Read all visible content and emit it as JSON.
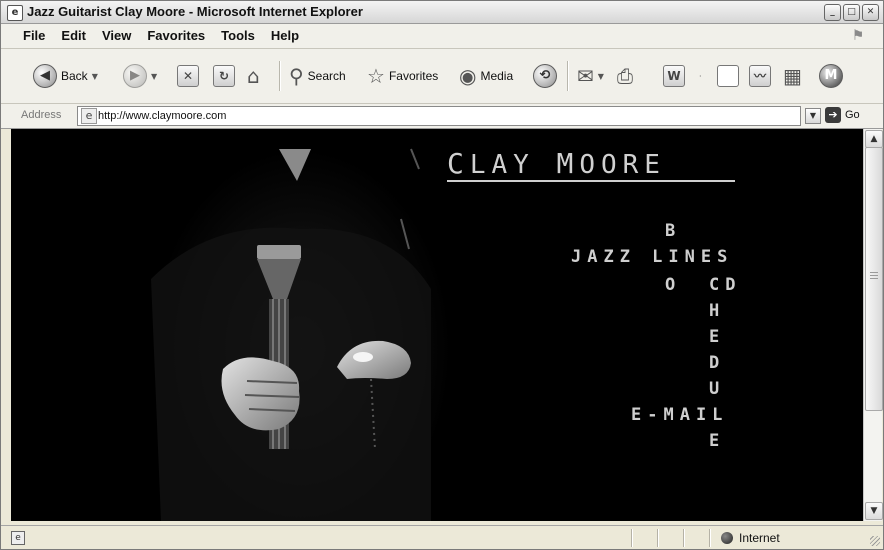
{
  "window": {
    "title": "Jazz Guitarist Clay Moore - Microsoft Internet Explorer",
    "app_icon": "ie-page-icon",
    "buttons": {
      "minimize": "minimize-icon",
      "maximize": "maximize-icon",
      "close": "close-icon"
    }
  },
  "menu": {
    "items": [
      "File",
      "Edit",
      "View",
      "Favorites",
      "Tools",
      "Help"
    ],
    "logo": "windows-flag-icon"
  },
  "toolbar": {
    "back_label": "Back",
    "search_label": "Search",
    "favorites_label": "Favorites",
    "media_label": "Media",
    "icons": [
      "back-icon",
      "forward-icon",
      "stop-icon",
      "refresh-icon",
      "home-icon",
      "search-icon",
      "favorites-icon",
      "media-icon",
      "history-icon",
      "mail-icon",
      "print-icon",
      "edit-icon",
      "discuss-icon",
      "messenger-icon",
      "research-icon",
      "msn-icon"
    ]
  },
  "address": {
    "label": "Address",
    "url": "http://www.claymoore.com",
    "go_label": "Go"
  },
  "site": {
    "title_first_initial": "C",
    "title_first_rest": "LAY",
    "title_last_initial": "M",
    "title_last_rest": "OORE",
    "nav": {
      "bio_b": "B",
      "jazz_lines": "JAZZ LINES",
      "bio_o": "O",
      "cd": "CD",
      "schedule_h": "H",
      "schedule_e": "E",
      "schedule_d": "D",
      "schedule_u": "U",
      "email": "E-MAIL",
      "schedule_e2": "E"
    }
  },
  "status": {
    "zone": "Internet"
  }
}
